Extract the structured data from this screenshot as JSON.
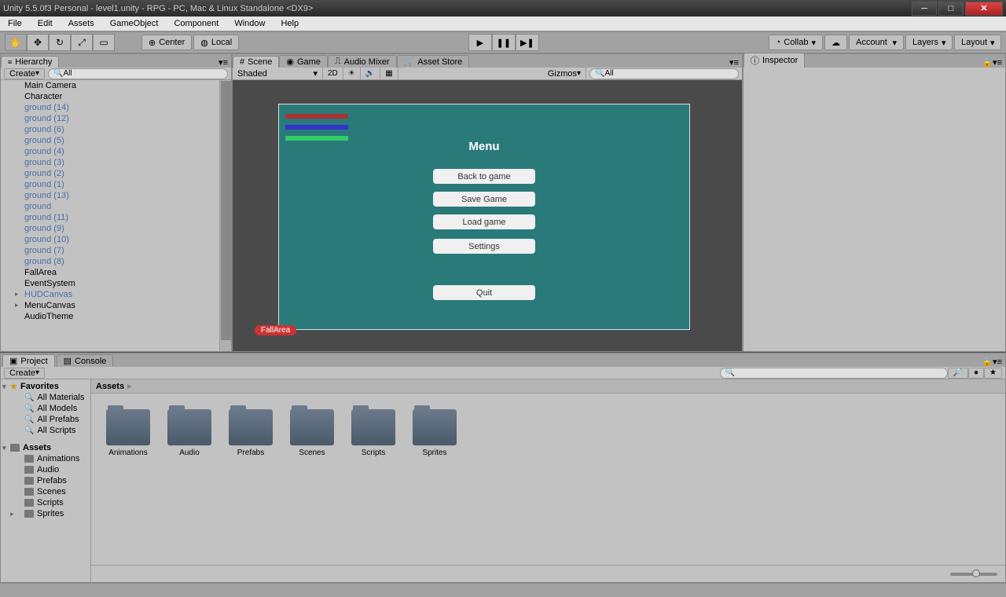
{
  "window": {
    "title": "Unity 5.5.0f3 Personal - level1.unity - RPG - PC, Mac & Linux Standalone <DX9>"
  },
  "menubar": [
    "File",
    "Edit",
    "Assets",
    "GameObject",
    "Component",
    "Window",
    "Help"
  ],
  "toolbar": {
    "center": "Center",
    "local": "Local",
    "collab": "Collab",
    "account": "Account",
    "layers": "Layers",
    "layout": "Layout"
  },
  "hierarchy": {
    "title": "Hierarchy",
    "create": "Create",
    "search_placeholder": "All",
    "items": [
      {
        "label": "Main Camera",
        "prefab": false
      },
      {
        "label": "Character",
        "prefab": false
      },
      {
        "label": "ground (14)",
        "prefab": true
      },
      {
        "label": "ground (12)",
        "prefab": true
      },
      {
        "label": "ground (6)",
        "prefab": true
      },
      {
        "label": "ground (5)",
        "prefab": true
      },
      {
        "label": "ground (4)",
        "prefab": true
      },
      {
        "label": "ground (3)",
        "prefab": true
      },
      {
        "label": "ground (2)",
        "prefab": true
      },
      {
        "label": "ground (1)",
        "prefab": true
      },
      {
        "label": "ground (13)",
        "prefab": true
      },
      {
        "label": "ground",
        "prefab": true
      },
      {
        "label": "ground (11)",
        "prefab": true
      },
      {
        "label": "ground (9)",
        "prefab": true
      },
      {
        "label": "ground (10)",
        "prefab": true
      },
      {
        "label": "ground (7)",
        "prefab": true
      },
      {
        "label": "ground (8)",
        "prefab": true
      },
      {
        "label": "FallArea",
        "prefab": false
      },
      {
        "label": "EventSystem",
        "prefab": false
      },
      {
        "label": "HUDCanvas",
        "prefab": true,
        "parent": true
      },
      {
        "label": "MenuCanvas",
        "prefab": false,
        "parent": true
      },
      {
        "label": "AudioTheme",
        "prefab": false
      }
    ]
  },
  "scene": {
    "tabs": {
      "scene": "Scene",
      "game": "Game",
      "audio": "Audio Mixer",
      "store": "Asset Store"
    },
    "mode": "Shaded",
    "dim": "2D",
    "gizmos": "Gizmos",
    "search_placeholder": "All",
    "menu_title": "Menu",
    "buttons": {
      "back": "Back to game",
      "save": "Save Game",
      "load": "Load game",
      "settings": "Settings",
      "quit": "Quit"
    },
    "fall_label": "FallArea"
  },
  "inspector": {
    "title": "Inspector"
  },
  "project": {
    "tabs": {
      "project": "Project",
      "console": "Console"
    },
    "create": "Create",
    "favorites": "Favorites",
    "fav_items": [
      "All Materials",
      "All Models",
      "All Prefabs",
      "All Scripts"
    ],
    "assets_label": "Assets",
    "tree": [
      "Animations",
      "Audio",
      "Prefabs",
      "Scenes",
      "Scripts",
      "Sprites"
    ],
    "breadcrumb": "Assets",
    "folders": [
      "Animations",
      "Audio",
      "Prefabs",
      "Scenes",
      "Scripts",
      "Sprites"
    ]
  }
}
